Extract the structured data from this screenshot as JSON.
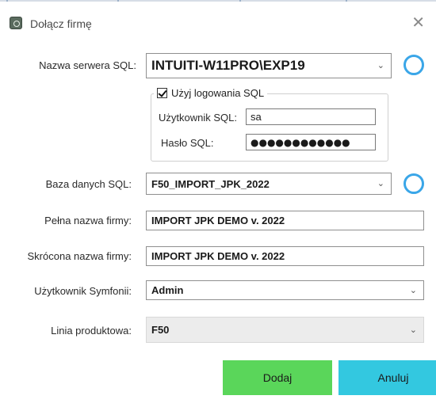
{
  "window": {
    "title": "Dołącz firmę",
    "close_icon": "✕"
  },
  "form": {
    "server": {
      "label": "Nazwa serwera SQL:",
      "value": "INTUITI-W11PRO\\EXP19"
    },
    "sql_login": {
      "checkbox_label": "Użyj logowania SQL",
      "checked": true,
      "user_label": "Użytkownik SQL:",
      "user_value": "sa",
      "password_label": "Hasło SQL:",
      "password_value": "●●●●●●●●●●●●"
    },
    "database": {
      "label": "Baza danych SQL:",
      "value": "F50_IMPORT_JPK_2022"
    },
    "full_name": {
      "label": "Pełna nazwa firmy:",
      "value": "IMPORT JPK DEMO v. 2022"
    },
    "short_name": {
      "label": "Skrócona nazwa firmy:",
      "value": "IMPORT JPK DEMO v. 2022"
    },
    "symfonia_user": {
      "label": "Użytkownik Symfonii:",
      "value": "Admin"
    },
    "product_line": {
      "label": "Linia produktowa:",
      "value": "F50"
    }
  },
  "buttons": {
    "add": "Dodaj",
    "cancel": "Anuluj"
  },
  "icons": {
    "chevron": "⌄"
  },
  "colors": {
    "add_button": "#5ad65a",
    "cancel_button": "#33c8e0",
    "spinner": "#3aa6e8"
  }
}
